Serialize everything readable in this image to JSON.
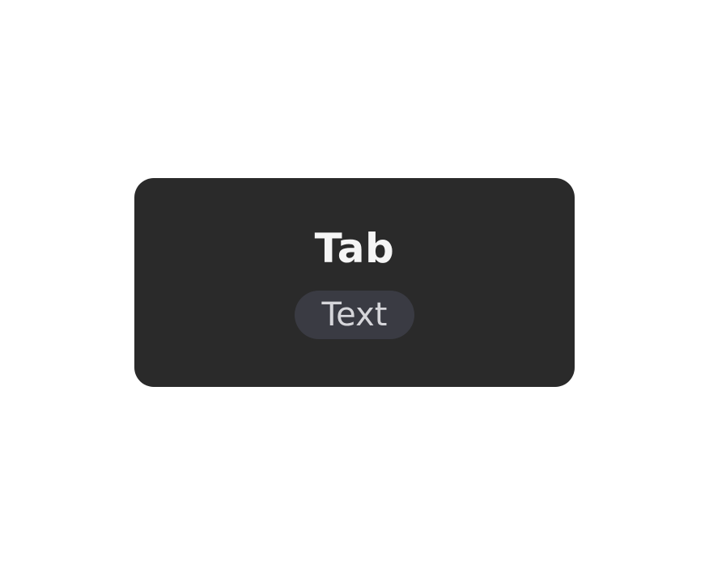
{
  "tab": {
    "title": "Tab",
    "chip_text": "Text"
  },
  "colors": {
    "page_background": "#ffffff",
    "card_background": "#2a2a2a",
    "title_text": "#f5f5f5",
    "chip_background": "#3a3b43",
    "chip_text": "#d6d6da"
  }
}
